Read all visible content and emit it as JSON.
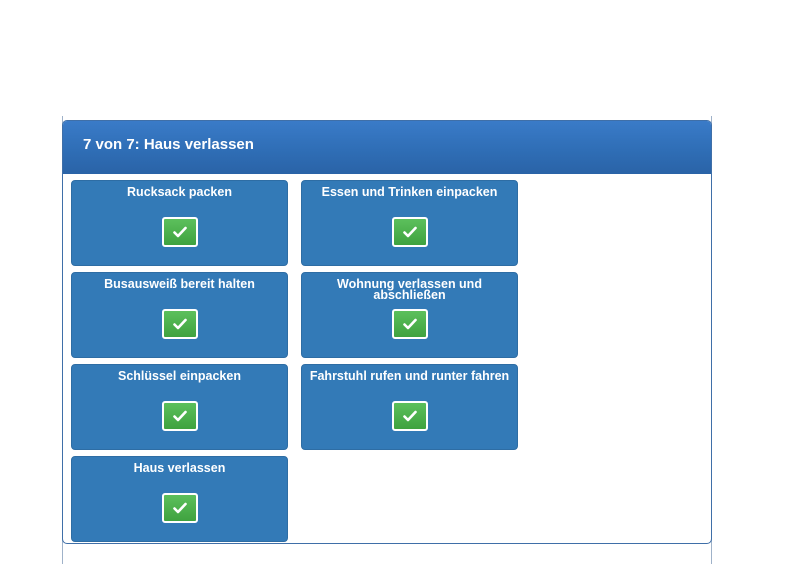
{
  "panel": {
    "title": "7 von 7: Haus verlassen"
  },
  "tasks": [
    {
      "label": "Rucksack packen",
      "done": true,
      "icon": "check-icon"
    },
    {
      "label": "Essen und Trinken einpacken",
      "done": true,
      "icon": "check-icon"
    },
    {
      "label": "Busausweiß bereit halten",
      "done": true,
      "icon": "check-icon"
    },
    {
      "label": "Wohnung verlassen und abschließen",
      "done": true,
      "icon": "check-icon"
    },
    {
      "label": "Schlüssel einpacken",
      "done": true,
      "icon": "check-icon"
    },
    {
      "label": "Fahrstuhl rufen und runter fahren",
      "done": true,
      "icon": "check-icon"
    },
    {
      "label": "Haus verlassen",
      "done": true,
      "icon": "check-icon"
    }
  ],
  "colors": {
    "header": "#2f6eb6",
    "tile": "#337ab7",
    "check": "#4cae4c"
  }
}
